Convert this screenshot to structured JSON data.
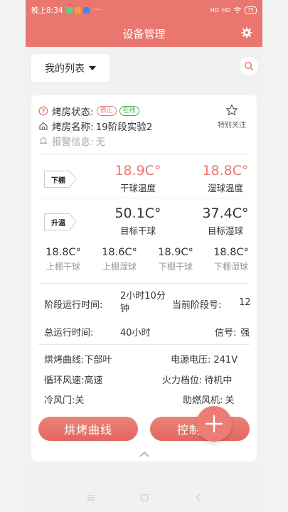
{
  "status_bar": {
    "time": "晚上8:34",
    "more": "···",
    "signal1": "HD",
    "signal2": "HD",
    "battery": "75"
  },
  "header": {
    "title": "设备管理"
  },
  "filter": {
    "dropdown_label": "我的列表"
  },
  "device": {
    "status_label": "烤房状态:",
    "status_tags": [
      "停止",
      "在线"
    ],
    "name_label": "烤房名称:",
    "name_value": "19阶段实验2",
    "alarm_label": "报警信息:",
    "alarm_value": "无",
    "favorite_label": "特别关注"
  },
  "sensors": {
    "lower_flag": "下棚",
    "dry_bulb_value": "18.9C°",
    "dry_bulb_label": "干球温度",
    "wet_bulb_value": "18.8C°",
    "wet_bulb_label": "湿球温度",
    "mode_flag": "升温",
    "target_dry_value": "50.1C°",
    "target_dry_label": "目标干球",
    "target_wet_value": "37.4C°",
    "target_wet_label": "目标湿球",
    "small": [
      {
        "value": "18.8C°",
        "label": "上棚干球"
      },
      {
        "value": "18.6C°",
        "label": "上棚湿球"
      },
      {
        "value": "18.9C°",
        "label": "下棚干球"
      },
      {
        "value": "18.8C°",
        "label": "下棚湿球"
      }
    ]
  },
  "run_info": {
    "stage_time_label": "阶段运行时间:",
    "stage_time_value_line1": "2小时10分",
    "stage_time_value_line2": "钟",
    "current_stage_label": "当前阶段号:",
    "current_stage_value": "12",
    "total_time_label": "总运行时间:",
    "total_time_value": "40小时",
    "signal_label": "信号:",
    "signal_value": "强"
  },
  "params": {
    "curve_label": "烘烤曲线:",
    "curve_value": "下部叶",
    "voltage_label": "电源电压:",
    "voltage_value": "241V",
    "fan_label": "循环风速:",
    "fan_value": "高速",
    "fire_label": "火力档位:",
    "fire_value": "待机中",
    "cold_door_label": "冷风门:",
    "cold_door_value": "关",
    "combustion_label": "助燃风机:",
    "combustion_value": "关"
  },
  "actions": {
    "curve_button": "烘烤曲线",
    "control_button": "控制"
  },
  "colors": {
    "accent": "#e9776f",
    "online": "#4caf50"
  }
}
